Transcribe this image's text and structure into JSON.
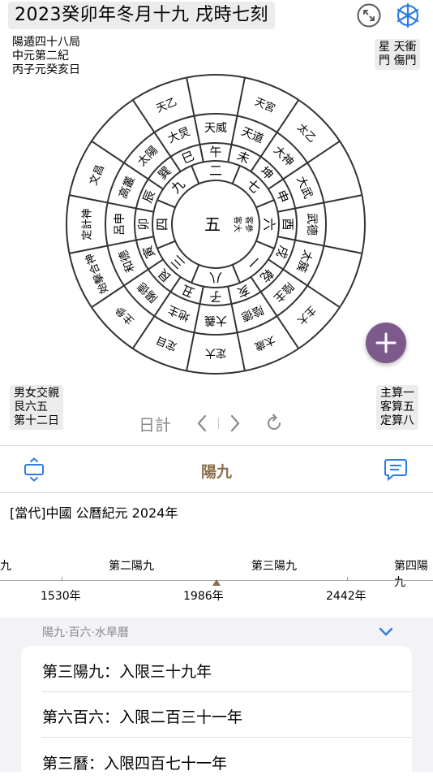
{
  "header": {
    "title": "2023癸卯年冬月十九 戌時七刻",
    "info_left": [
      "陽遁四十八局",
      "中元第二紀",
      "丙子元癸亥日"
    ],
    "info_right": [
      "星 天衝",
      "門 傷門"
    ]
  },
  "bottom_left": [
    "男女交親",
    "艮六五",
    "第十二日"
  ],
  "bottom_right": [
    "主算一",
    "客算五",
    "定算八"
  ],
  "nav": {
    "mode_label": "日計"
  },
  "section_bar": {
    "title": "陽九"
  },
  "era": {
    "text": "[當代]中國  公曆紀元 2024年"
  },
  "timeline": {
    "labels": [
      "陽九",
      "第二陽九",
      "第三陽九",
      "第四陽九"
    ],
    "years": [
      "1530年",
      "1986年",
      "2442年"
    ]
  },
  "list": {
    "header": "陽九·百六·水旱曆",
    "rows": [
      "第三陽九：入限三十九年",
      "第六百六：入限二百三十一年",
      "第三曆：入限四百七十一年"
    ]
  },
  "wheel": {
    "center": "五",
    "center_side": [
      "客大",
      "客參"
    ],
    "inner_ring": [
      "二",
      "七",
      "六",
      "一",
      "八",
      "三",
      "四",
      "九"
    ],
    "branches": [
      "午",
      "未",
      "申",
      "酉",
      "戌",
      "亥",
      "子",
      "丑",
      "寅",
      "卯",
      "辰",
      "巳"
    ],
    "trigrams": [
      "坤",
      "乾",
      "艮",
      "巽"
    ],
    "gods": [
      "天威",
      "天道",
      "大神",
      "大武",
      "武德",
      "太簇",
      "陰主",
      "陰德",
      "大義",
      "地主",
      "陽德",
      "和德",
      "呂申",
      "高叢",
      "太陽",
      "大炅"
    ],
    "outer_ring": [
      "天乙",
      "天宮",
      "太乙",
      "文昌",
      "定計神",
      "始擊合神",
      "主參",
      "定目",
      "定大",
      "太歲",
      "主大"
    ]
  },
  "colors": {
    "accent_purple": "#7d5a8c",
    "accent_blue": "#2d7ce0",
    "title_brown": "#8a6d4b"
  },
  "icons": [
    "collapse-icon",
    "settings-wheel-icon",
    "plus-icon",
    "expand-vertical-icon",
    "chat-icon",
    "chevron-left-icon",
    "chevron-right-icon",
    "refresh-icon",
    "chevron-down-icon"
  ]
}
